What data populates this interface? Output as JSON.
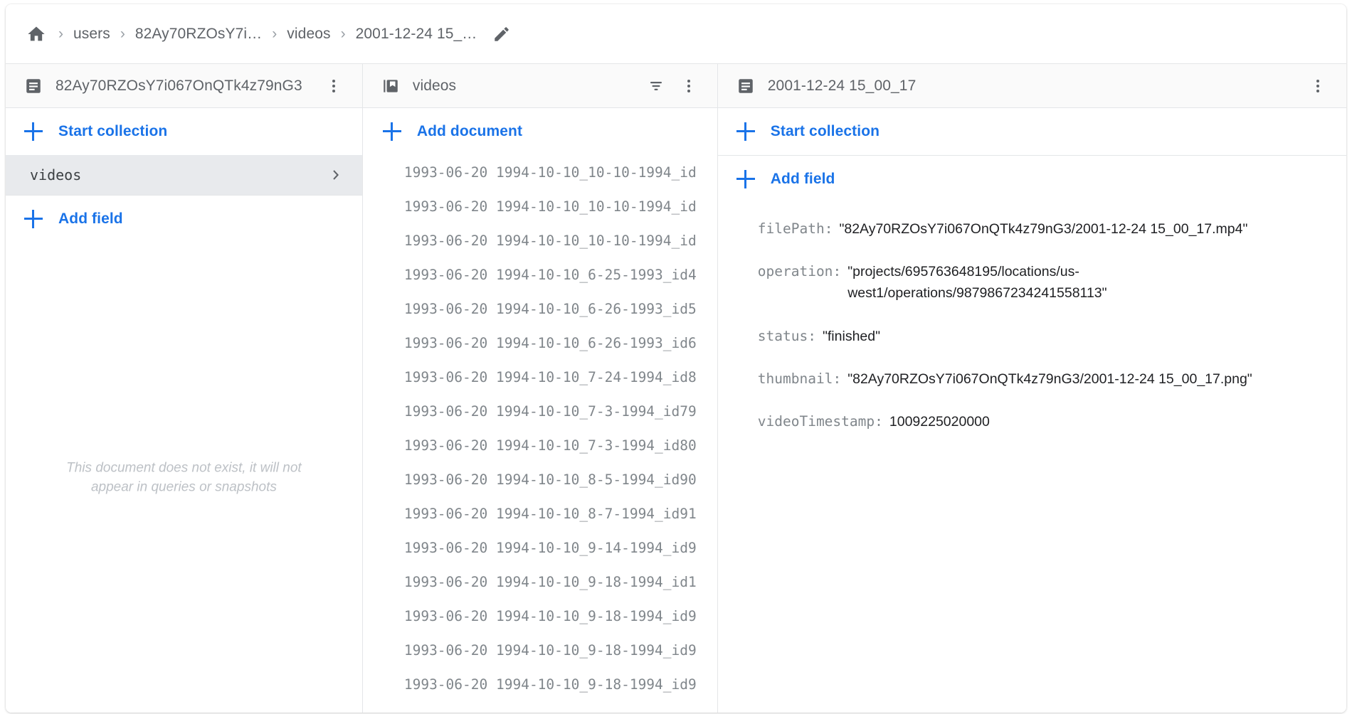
{
  "breadcrumb": {
    "home_icon": "home-icon",
    "separator": "›",
    "edit_icon": "pencil-edit-icon",
    "items": [
      {
        "label": "users"
      },
      {
        "label": "82Ay70RZOsY7i…"
      },
      {
        "label": "videos"
      },
      {
        "label": "2001-12-24 15_…"
      }
    ]
  },
  "left_panel": {
    "icon": "document-icon",
    "title": "82Ay70RZOsY7i067OnQTk4z79nG3",
    "more_icon": "more-vert-icon",
    "start_collection_label": "Start collection",
    "add_field_label": "Add field",
    "collections": [
      {
        "label": "videos",
        "selected": true,
        "chevron": "chevron-right-icon"
      }
    ],
    "empty_note": "This document does not exist, it will not appear in queries or snapshots"
  },
  "middle_panel": {
    "icon": "collection-icon",
    "title": "videos",
    "filter_icon": "filter-list-icon",
    "more_icon": "more-vert-icon",
    "add_document_label": "Add document",
    "documents": [
      {
        "label": "1993-06-20 1994-10-10_10-10-1994_id"
      },
      {
        "label": "1993-06-20 1994-10-10_10-10-1994_id"
      },
      {
        "label": "1993-06-20 1994-10-10_10-10-1994_id"
      },
      {
        "label": "1993-06-20 1994-10-10_6-25-1993_id4"
      },
      {
        "label": "1993-06-20 1994-10-10_6-26-1993_id5"
      },
      {
        "label": "1993-06-20 1994-10-10_6-26-1993_id6"
      },
      {
        "label": "1993-06-20 1994-10-10_7-24-1994_id8"
      },
      {
        "label": "1993-06-20 1994-10-10_7-3-1994_id79"
      },
      {
        "label": "1993-06-20 1994-10-10_7-3-1994_id80"
      },
      {
        "label": "1993-06-20 1994-10-10_8-5-1994_id90"
      },
      {
        "label": "1993-06-20 1994-10-10_8-7-1994_id91"
      },
      {
        "label": "1993-06-20 1994-10-10_9-14-1994_id9"
      },
      {
        "label": "1993-06-20 1994-10-10_9-18-1994_id1"
      },
      {
        "label": "1993-06-20 1994-10-10_9-18-1994_id9"
      },
      {
        "label": "1993-06-20 1994-10-10_9-18-1994_id9"
      },
      {
        "label": "1993-06-20 1994-10-10_9-18-1994_id9"
      }
    ]
  },
  "right_panel": {
    "icon": "document-icon",
    "title": "2001-12-24 15_00_17",
    "more_icon": "more-vert-icon",
    "start_collection_label": "Start collection",
    "add_field_label": "Add field",
    "fields": [
      {
        "key": "filePath",
        "value": "\"82Ay70RZOsY7i067OnQTk4z79nG3/2001-12-24 15_00_17.mp4\""
      },
      {
        "key": "operation",
        "value": "\"projects/695763648195/locations/us-west1/operations/9879867234241558113\""
      },
      {
        "key": "status",
        "value": "\"finished\""
      },
      {
        "key": "thumbnail",
        "value": "\"82Ay70RZOsY7i067OnQTk4z79nG3/2001-12-24 15_00_17.png\""
      },
      {
        "key": "videoTimestamp",
        "value": "1009225020000"
      }
    ]
  },
  "colors": {
    "accent": "#1a73e8",
    "header_bg": "#fafafa",
    "selected_row": "#e8eaed",
    "border": "#e4e6e8",
    "text_primary": "#202124",
    "text_secondary": "#5f6368",
    "text_muted": "#80868b",
    "text_disabled": "#bdc1c6"
  }
}
